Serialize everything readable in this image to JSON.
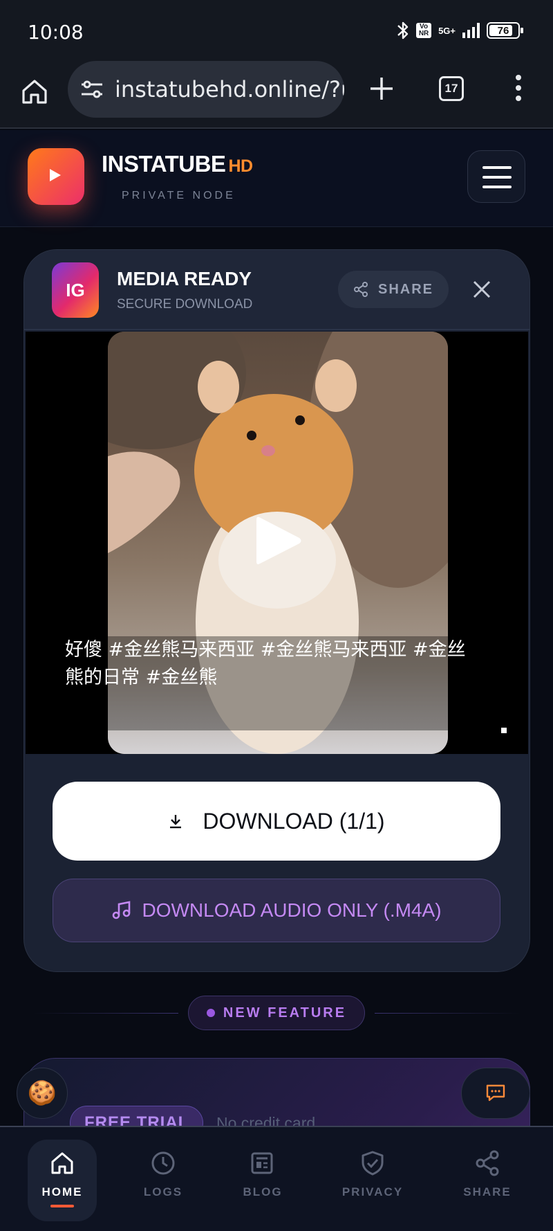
{
  "status_bar": {
    "time": "10:08",
    "network": "5G+",
    "battery": "76"
  },
  "browser": {
    "url": "instatubehd.online/?u",
    "tab_count": "17"
  },
  "header": {
    "brand": "INSTATUBE",
    "brand_suffix": "HD",
    "tagline": "PRIVATE NODE"
  },
  "media_card": {
    "badge": "IG",
    "title": "MEDIA READY",
    "subtitle": "SECURE DOWNLOAD",
    "share_label": "SHARE",
    "caption": "好傻 #金丝熊马来西亚 #金丝熊马来西亚 #金丝熊的日常 #金丝熊",
    "download_label": "DOWNLOAD (1/1)",
    "audio_label": "DOWNLOAD AUDIO ONLY (.M4A)"
  },
  "feature": {
    "label": "NEW FEATURE"
  },
  "promo": {
    "badge": "FREE TRIAL",
    "note": "No credit card"
  },
  "bottom_nav": {
    "items": [
      {
        "label": "HOME"
      },
      {
        "label": "LOGS"
      },
      {
        "label": "BLOG"
      },
      {
        "label": "PRIVACY"
      },
      {
        "label": "SHARE"
      }
    ]
  },
  "colors": {
    "accent_orange": "#ff8c2e",
    "accent_purple": "#c489f3",
    "background": "#080b14"
  }
}
